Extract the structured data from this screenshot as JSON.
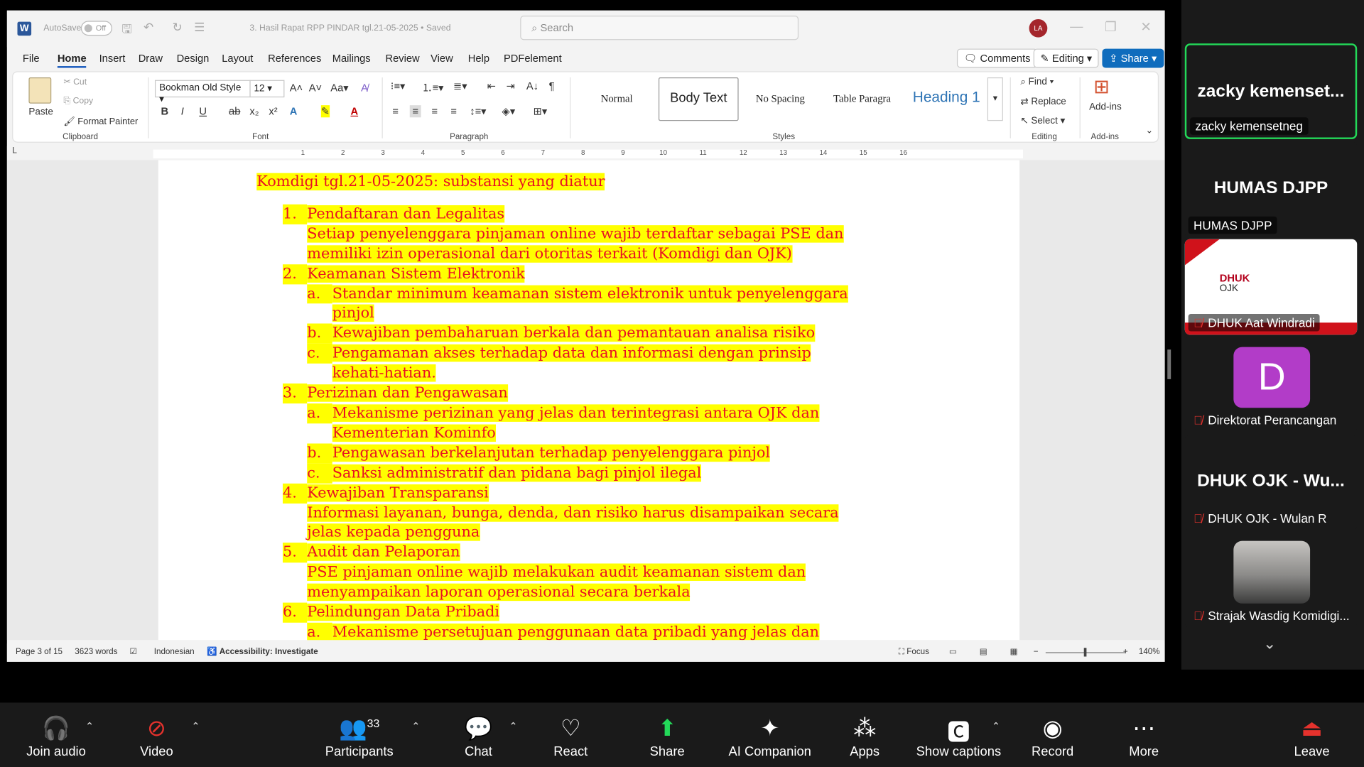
{
  "word": {
    "autosave_label": "AutoSave",
    "autosave_state": "Off",
    "doc_title": "3. Hasil Rapat RPP PINDAR tgl.21-05-2025 • Saved",
    "search_placeholder": "Search",
    "avatar_initials": "LA",
    "menu_tabs": [
      "File",
      "Home",
      "Insert",
      "Draw",
      "Design",
      "Layout",
      "References",
      "Mailings",
      "Review",
      "View",
      "Help",
      "PDFelement"
    ],
    "comments_label": "Comments",
    "editing_label": "Editing",
    "share_label": "Share",
    "ribbon": {
      "paste": "Paste",
      "cut": "Cut",
      "copy": "Copy",
      "format_painter": "Format Painter",
      "clipboard": "Clipboard",
      "font_name": "Bookman Old Style",
      "font_size": "12",
      "font": "Font",
      "paragraph": "Paragraph",
      "styles_label": "Styles",
      "styles": [
        "Normal",
        "Body Text",
        "No Spacing",
        "Table Paragra",
        "Heading 1"
      ],
      "find": "Find",
      "replace": "Replace",
      "select": "Select",
      "editing": "Editing",
      "addins": "Add-ins",
      "addins_group": "Add-ins"
    },
    "ruler_numbers": [
      "1",
      "2",
      "3",
      "4",
      "5",
      "6",
      "7",
      "8",
      "9",
      "10",
      "11",
      "12",
      "13",
      "14",
      "15",
      "16"
    ],
    "document": {
      "title": "Komdigi tgl.21-05-2025: substansi yang diatur",
      "lines": [
        {
          "marker": "1.",
          "text": "Pendaftaran dan Legalitas",
          "level": 1
        },
        {
          "marker": "",
          "text": "Setiap penyelenggara pinjaman online wajib terdaftar sebagai PSE dan",
          "level": 1
        },
        {
          "marker": "",
          "text": "memiliki izin operasional dari otoritas terkait (Komdigi dan OJK)",
          "level": 1
        },
        {
          "marker": "2.",
          "text": "Keamanan Sistem Elektronik",
          "level": 1
        },
        {
          "marker": "a.",
          "text": "Standar minimum keamanan sistem elektronik untuk penyelenggara",
          "level": 2
        },
        {
          "marker": "",
          "text": "pinjol",
          "level": 2
        },
        {
          "marker": "b.",
          "text": "Kewajiban pembaharuan berkala dan pemantauan analisa risiko",
          "level": 2
        },
        {
          "marker": "c.",
          "text": "Pengamanan akses terhadap data dan informasi dengan prinsip",
          "level": 2
        },
        {
          "marker": "",
          "text": "kehati-hatian.",
          "level": 2
        },
        {
          "marker": "3.",
          "text": "Perizinan dan Pengawasan",
          "level": 1
        },
        {
          "marker": "a.",
          "text": "Mekanisme perizinan yang jelas dan terintegrasi antara OJK dan",
          "level": 2
        },
        {
          "marker": "",
          "text": "Kementerian Kominfo",
          "level": 2
        },
        {
          "marker": "b.",
          "text": "Pengawasan berkelanjutan terhadap penyelenggara pinjol",
          "level": 2
        },
        {
          "marker": "c.",
          "text": "Sanksi administratif dan pidana bagi pinjol ilegal",
          "level": 2
        },
        {
          "marker": "4.",
          "text": "Kewajiban Transparansi",
          "level": 1
        },
        {
          "marker": "",
          "text": "Informasi layanan, bunga, denda, dan risiko harus disampaikan secara",
          "level": 1
        },
        {
          "marker": "",
          "text": "jelas kepada pengguna",
          "level": 1
        },
        {
          "marker": "5.",
          "text": "Audit dan Pelaporan",
          "level": 1
        },
        {
          "marker": "",
          "text": "PSE pinjaman online wajib melakukan audit keamanan sistem dan",
          "level": 1
        },
        {
          "marker": "",
          "text": "menyampaikan laporan operasional secara berkala",
          "level": 1
        },
        {
          "marker": "6.",
          "text": "Pelindungan Data Pribadi",
          "level": 1
        },
        {
          "marker": "a.",
          "text": "Mekanisme persetujuan penggunaan data pribadi yang jelas dan",
          "level": 2
        }
      ]
    },
    "status": {
      "page": "Page 3 of 15",
      "words": "3623 words",
      "language": "Indonesian",
      "accessibility": "Accessibility: Investigate",
      "focus": "Focus",
      "zoom": "140%"
    }
  },
  "zoom": {
    "participants": [
      {
        "big": "zacky  kemenset...",
        "name": "zacky kemensetneg",
        "muted": false,
        "active": true
      },
      {
        "big": "HUMAS DJPP",
        "name": "HUMAS DJPP",
        "muted": false
      },
      {
        "big": "",
        "name": "DHUK Aat Windradi",
        "muted": true,
        "slide_title": "DHUK",
        "slide_sub": "OJK"
      },
      {
        "big": "D",
        "name": "Direktorat Perancangan",
        "muted": true
      },
      {
        "big": "DHUK OJK - Wu...",
        "name": "DHUK OJK - Wulan R",
        "muted": true
      },
      {
        "big": "",
        "name": "Strajak Wasdig Komidigi...",
        "muted": true
      }
    ],
    "participants_count": "33",
    "toolbar": {
      "join_audio": "Join audio",
      "video": "Video",
      "participants": "Participants",
      "chat": "Chat",
      "react": "React",
      "share": "Share",
      "ai_companion": "AI Companion",
      "apps": "Apps",
      "show_captions": "Show captions",
      "record": "Record",
      "more": "More",
      "leave": "Leave"
    },
    "colors": {
      "accent_green": "#23d959",
      "mute_red": "#e5322d",
      "avatar_purple": "#b23cc8"
    }
  }
}
